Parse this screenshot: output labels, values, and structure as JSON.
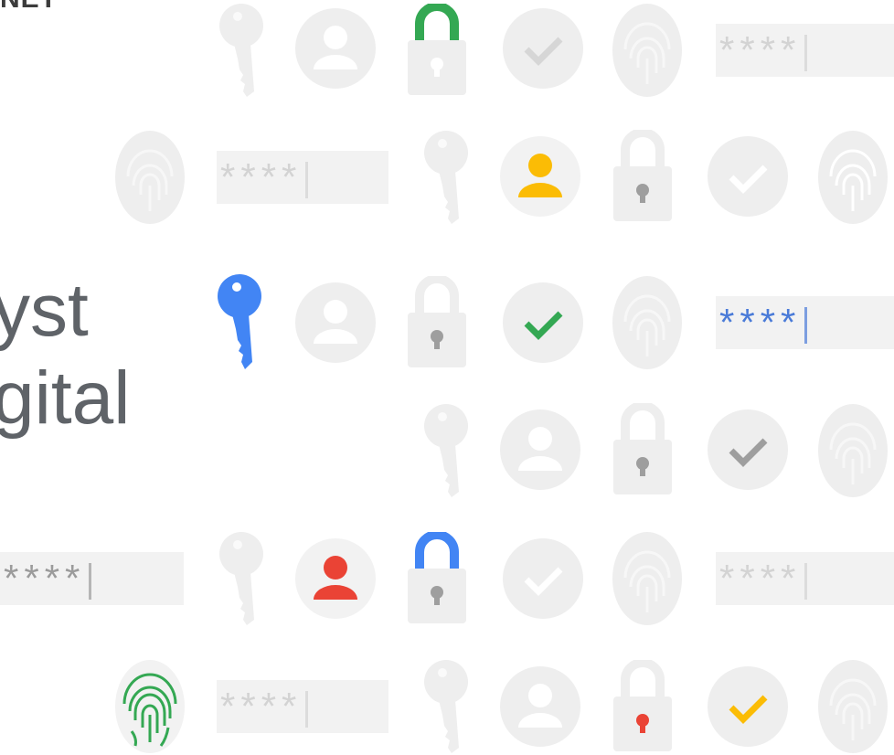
{
  "brand": {
    "partial_text": "NET"
  },
  "headline": {
    "text": "yst\ngital"
  },
  "password_mask": "****",
  "colors": {
    "faint": "#eeeeee",
    "faint_detail": "#ffffff",
    "google_green": "#34a853",
    "google_blue": "#4285f4",
    "google_yellow": "#fbbc05",
    "google_red": "#ea4335"
  },
  "icons": [
    "key-icon",
    "user-icon",
    "lock-icon",
    "checkmark-icon",
    "fingerprint-icon",
    "password-field"
  ]
}
